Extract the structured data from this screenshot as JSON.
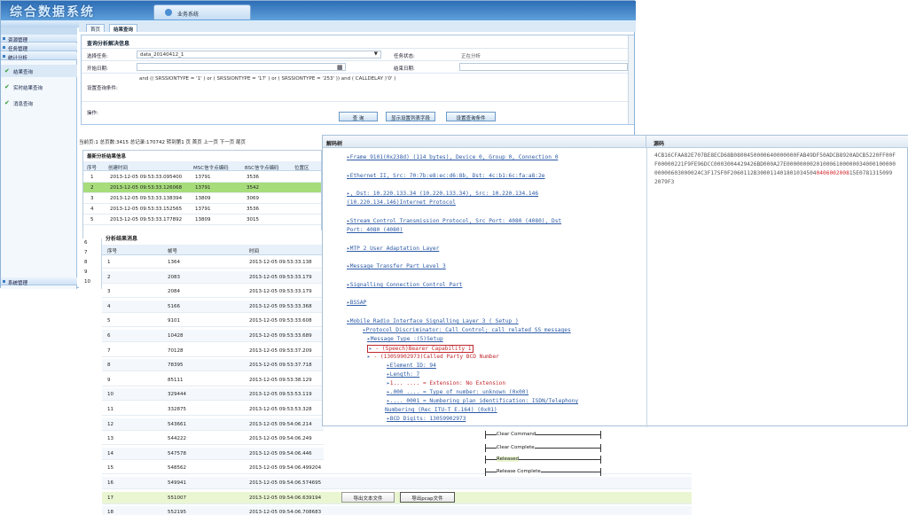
{
  "app": {
    "logo": "综合数据系统",
    "system_tab": "业务系统"
  },
  "sidebar": {
    "groups": [
      "资源管理",
      "任务管理",
      "统计分析"
    ],
    "items": [
      "结果查询",
      "实时结果查询",
      "消息查询"
    ],
    "bottom": "系统管理"
  },
  "tabs": [
    "首页",
    "结果查询"
  ],
  "query": {
    "title": "查询分析解决信息",
    "select_task_label": "选择任务:",
    "select_task_value": "data_20140412_1",
    "task_status_label": "任务状态:",
    "task_status_value": "正在分析",
    "start_date_label": "开始日期:",
    "end_date_label": "结束日期:",
    "condition_label": "设置查询条件:",
    "condition_value": "and (( SRSSIONTYPE = '1' ) or ( SRSSIONTYPE = '17' ) or ( SRSSIONTYPE = '253' )) and ( CALLDELAY )'0' )",
    "op_label": "操作:",
    "btn_query": "查 询",
    "btn_show_fields": "显示设置列表字段",
    "btn_set_cond": "设置查询条件"
  },
  "pager": {
    "text": "当前页:1  总页数:3415  总记录:170742  转到第1  页  首页  上一页  下一页  尾页"
  },
  "task_table": {
    "title": "最新分析结果信息",
    "headers": [
      "序号",
      "创建时间",
      "MSC信令点编码",
      "BSC信令点编码",
      "位置区"
    ],
    "rows": [
      [
        "1",
        "2013-12-05 09:53:33.095400",
        "13791",
        "3536"
      ],
      [
        "2",
        "2013-12-05 09:53:33.126068",
        "13791",
        "3542"
      ],
      [
        "3",
        "2013-12-05 09:53:33.138394",
        "13809",
        "3069"
      ],
      [
        "4",
        "2013-12-05 09:53:33.152565",
        "13791",
        "3536"
      ],
      [
        "5",
        "2013-12-05 09:53:33.177892",
        "13809",
        "3015"
      ]
    ],
    "left_nums": [
      "6",
      "7",
      "8",
      "9",
      "10"
    ]
  },
  "result": {
    "title": "分析结果消息",
    "headers": [
      "序号",
      "帧号",
      "时间"
    ],
    "rows": [
      [
        "1",
        "1364",
        "2013-12-05 09:53:33.138"
      ],
      [
        "2",
        "2083",
        "2013-12-05 09:53:33.179"
      ],
      [
        "3",
        "2084",
        "2013-12-05 09:53:33.179"
      ],
      [
        "4",
        "5166",
        "2013-12-05 09:53:33.368"
      ],
      [
        "5",
        "9101",
        "2013-12-05 09:53:33.608"
      ],
      [
        "6",
        "10428",
        "2013-12-05 09:53:33.689"
      ],
      [
        "7",
        "70128",
        "2013-12-05 09:53:37.209"
      ],
      [
        "8",
        "78395",
        "2013-12-05 09:53:37.718"
      ],
      [
        "9",
        "85111",
        "2013-12-05 09:53:38.129"
      ],
      [
        "10",
        "329444",
        "2013-12-05 09:53:53.119"
      ],
      [
        "11",
        "332875",
        "2013-12-05 09:53:53.328"
      ],
      [
        "12",
        "543661",
        "2013-12-05 09:54:06.214"
      ],
      [
        "13",
        "544222",
        "2013-12-05 09:54:06.249"
      ],
      [
        "14",
        "547578",
        "2013-12-05 09:54:06.446"
      ],
      [
        "15",
        "548562",
        "2013-12-05 09:54:06.499204"
      ],
      [
        "16",
        "549941",
        "2013-12-05 09:54:06.574695"
      ],
      [
        "17",
        "551007",
        "2013-12-05 09:54:06.639194"
      ],
      [
        "18",
        "552195",
        "2013-12-05 09:54:06.708683"
      ]
    ],
    "signals": [
      "Clear Command",
      "Clear Complete",
      "Released",
      "Release Complete"
    ]
  },
  "decode": {
    "tree_header": "解码树",
    "hex_header": "源码",
    "lines": [
      "Frame 9101(0x238d) (114 bytes), Device 0, Group 0, Connection 0",
      "Ethernet II, Src: 70:7b:e8:ec:d6:8b, Dst: 4c:b1:6c:fa:a8:2e",
      ", Dst: 10.220.133.34 (10.220.133.34), Src: 10.220.134.146",
      "(10.220.134.146)Internet Protocol",
      "Stream Control Transmission Protocol, Src Port: 4080 (4080), Dst",
      "Port: 4080 (4080)",
      "MTP 2 User Adaptation Layer",
      "Message Transfer Part Level 3",
      "Signalling Connection Control Part",
      "BSSAP",
      "Mobile Radio Interface Signalling Layer 3 ( Setup )",
      "Protocol Discriminator: Call Control; call related SS messages",
      "Message Type :(5)Setup",
      " - (Speech)Bearer Capability 1",
      " - (13059902973)Called Party BCD Number",
      "Element ID: 94",
      "Length: 7",
      "1... .... = Extension: No Extension",
      ".000 .... = Type of number: unknown (0x00)",
      ".... 0001 = Numbering plan identification: ISDN/Telephony",
      "Numbering (Rec ITU-T E.164) (0x01)",
      "BCD Digits: 13059902973"
    ],
    "hex_pre": "4CB16CFAA82E707BE8ECD68B0800450000640000000FAB49DF50ADCB8920ADCB5220FF00FF00000221F9FE96DCC0003004429426BD000A27E00000000201000610000003400010000000000603000024C3F17SF0F2060112B300011401801034504",
    "hex_red": "0406002008",
    "hex_post": "15E0781315099 2079F3"
  },
  "bottom": {
    "btn_export_text": "导出文本文件",
    "btn_export_pcap": "导出pcap文件"
  }
}
